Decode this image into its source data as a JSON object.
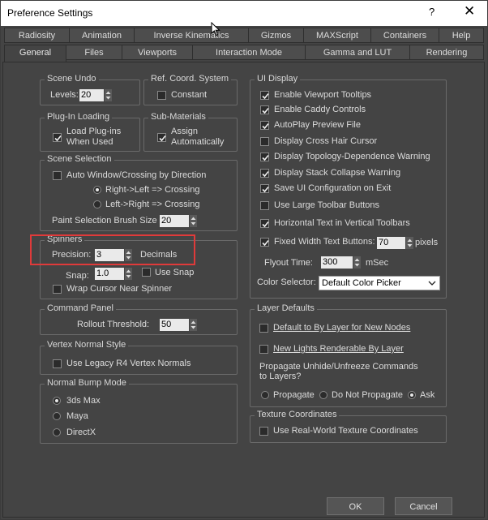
{
  "window": {
    "title": "Preference Settings",
    "help": "?",
    "close": "✕"
  },
  "tabs_top": [
    "Radiosity",
    "Animation",
    "Inverse Kinematics",
    "Gizmos",
    "MAXScript",
    "Containers",
    "Help"
  ],
  "tabs_bottom": [
    "General",
    "Files",
    "Viewports",
    "Interaction Mode",
    "Gamma and LUT",
    "Rendering"
  ],
  "active_tab": "General",
  "scene_undo": {
    "title": "Scene Undo",
    "levels_label": "Levels:",
    "levels_value": "20"
  },
  "ref_coord": {
    "title": "Ref. Coord. System",
    "constant_label": "Constant",
    "constant_checked": false
  },
  "plugin_loading": {
    "title": "Plug-In Loading",
    "load_label_1": "Load Plug-ins",
    "load_label_2": "When Used",
    "checked": true
  },
  "sub_materials": {
    "title": "Sub-Materials",
    "assign_label_1": "Assign",
    "assign_label_2": "Automatically",
    "checked": true
  },
  "scene_selection": {
    "title": "Scene Selection",
    "auto_window_label": "Auto Window/Crossing by Direction",
    "auto_window_checked": false,
    "right_left_label": "Right->Left => Crossing",
    "left_right_label": "Left->Right => Crossing",
    "selected_radio": "Right->Left => Crossing",
    "brush_label": "Paint Selection Brush Size",
    "brush_value": "20"
  },
  "spinners": {
    "title": "Spinners",
    "precision_label": "Precision:",
    "precision_value": "3",
    "decimals_label": "Decimals",
    "snap_label": "Snap:",
    "snap_value": "1.0",
    "use_snap_label": "Use Snap",
    "use_snap_checked": false,
    "wrap_label": "Wrap Cursor Near Spinner",
    "wrap_checked": false
  },
  "command_panel": {
    "title": "Command Panel",
    "rollout_label": "Rollout Threshold:",
    "rollout_value": "50"
  },
  "vertex_normal": {
    "title": "Vertex Normal Style",
    "legacy_label": "Use Legacy R4 Vertex Normals",
    "legacy_checked": false
  },
  "normal_bump": {
    "title": "Normal Bump Mode",
    "options": [
      "3ds Max",
      "Maya",
      "DirectX"
    ],
    "selected": "3ds Max"
  },
  "ui_display": {
    "title": "UI Display",
    "items": [
      {
        "label": "Enable Viewport Tooltips",
        "checked": true
      },
      {
        "label": "Enable Caddy Controls",
        "checked": true
      },
      {
        "label": "AutoPlay Preview File",
        "checked": true
      },
      {
        "label": "Display Cross Hair Cursor",
        "checked": false
      },
      {
        "label": "Display Topology-Dependence Warning",
        "checked": true
      },
      {
        "label": "Display Stack Collapse Warning",
        "checked": true
      },
      {
        "label": "Save UI Configuration on Exit",
        "checked": true
      },
      {
        "label": "Use Large Toolbar Buttons",
        "checked": false
      },
      {
        "label": "Horizontal Text in Vertical Toolbars",
        "checked": true
      },
      {
        "label": "Fixed Width Text Buttons:",
        "checked": true
      }
    ],
    "fixed_width_value": "70",
    "pixels_label": "pixels",
    "flyout_label": "Flyout Time:",
    "flyout_value": "300",
    "msec_label": "mSec",
    "color_selector_label": "Color Selector:",
    "color_selector_value": "Default Color Picker"
  },
  "layer_defaults": {
    "title": "Layer Defaults",
    "default_by_layer_label": "Default to By Layer for New Nodes",
    "default_by_layer_checked": false,
    "new_lights_label": "New Lights Renderable By Layer",
    "new_lights_checked": false,
    "propagate_question_1": "Propagate Unhide/Unfreeze Commands",
    "propagate_question_2": "to Layers?",
    "propagate_options": [
      "Propagate",
      "Do Not Propagate",
      "Ask"
    ],
    "propagate_selected": "Ask"
  },
  "texture_coords": {
    "title": "Texture Coordinates",
    "real_world_label": "Use Real-World Texture Coordinates",
    "checked": false
  },
  "buttons": {
    "ok": "OK",
    "cancel": "Cancel"
  },
  "colors": {
    "panel_bg": "#444444",
    "highlight": "#e03a3a",
    "field_bg": "#eaeaea"
  }
}
